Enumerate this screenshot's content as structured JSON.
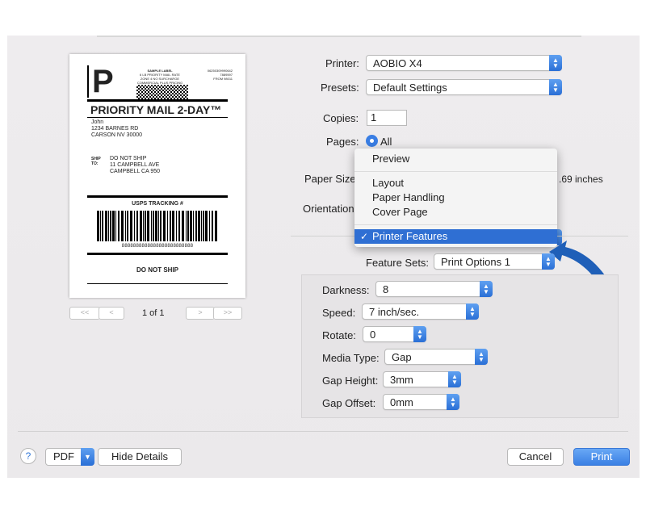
{
  "preview": {
    "sample_label": "SAMPLE LABEL",
    "rate_lines": [
      "6 LB PRIORITY MAIL RATE",
      "ZONE 4 NO SURCHARGE",
      "COMMERCIAL PLUS PRICING"
    ],
    "code_lines": [
      "06250309990642",
      "7889597",
      "FROM 98011"
    ],
    "service": "PRIORITY MAIL 2-DAY™",
    "from_lines": [
      "John",
      "1234 BARNES RD",
      "CARSON NV 30000"
    ],
    "ship_to_label": "SHIP\nTO:",
    "to_lines": [
      "DO NOT SHIP",
      "11 CAMPBELL AVE",
      "CAMPBELL CA 950"
    ],
    "tracking_title": "USPS TRACKING #",
    "tracking_number": "8888888888888888888888888",
    "footer": "DO NOT SHIP",
    "big_letter": "P",
    "page_indicator": "1 of 1",
    "nav_first": "<<",
    "nav_prev": "<",
    "nav_next": ">",
    "nav_last": ">>"
  },
  "form": {
    "printer_label": "Printer:",
    "printer_value": "AOBIO X4",
    "presets_label": "Presets:",
    "presets_value": "Default Settings",
    "copies_label": "Copies:",
    "copies_value": "1",
    "pages_label": "Pages:",
    "pages_value": "All",
    "paper_size_label": "Paper Size",
    "paper_size_suffix": ".69 inches",
    "orientation_label": "Orientation"
  },
  "menu": {
    "items": [
      "Preview",
      "Layout",
      "Paper Handling",
      "Cover Page",
      "Printer Features"
    ],
    "selected": "Printer Features",
    "checkmark": "✓"
  },
  "features": {
    "feature_sets_label": "Feature Sets:",
    "feature_sets_value": "Print Options 1",
    "darkness_label": "Darkness:",
    "darkness_value": "8",
    "speed_label": "Speed:",
    "speed_value": "7 inch/sec.",
    "rotate_label": "Rotate:",
    "rotate_value": "0",
    "media_type_label": "Media Type:",
    "media_type_value": "Gap",
    "gap_height_label": "Gap Height:",
    "gap_height_value": "3mm",
    "gap_offset_label": "Gap Offset:",
    "gap_offset_value": "0mm"
  },
  "buttons": {
    "help": "?",
    "pdf": "PDF",
    "hide_details": "Hide Details",
    "cancel": "Cancel",
    "print": "Print"
  },
  "colors": {
    "accent": "#2f6fd3",
    "print_button": "#4a8fe6",
    "callout_arrow": "#1f5fb8"
  }
}
